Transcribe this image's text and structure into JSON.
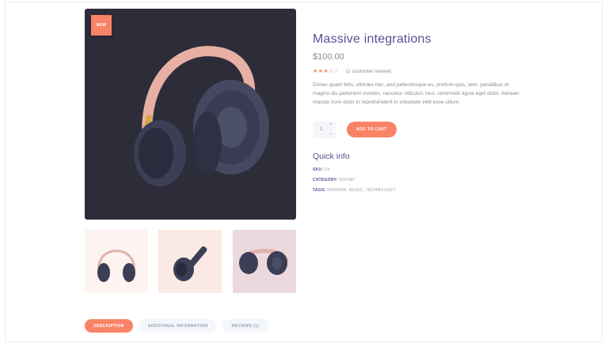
{
  "product": {
    "badge": "NEW",
    "title": "Massive integrations",
    "price": "$100.00",
    "rating": 3,
    "rating_stars": "★★★☆☆",
    "reviews_text": "(1 customer review)",
    "description": "Donec quam felis, ultricies nec, and pellentesque eu, pretium quis, sem. penatibus et magnis dis parturient montes, nascetur ridiculus mus. commodo ligula eget dolor. Aenean masste irure dolor in reprehenderit in voluptate velit esse cillum.",
    "quantity": "1",
    "add_to_cart": "ADD TO CART"
  },
  "quick_info": {
    "title": "Quick info",
    "sku_label": "SKU:",
    "sku_value": "04",
    "category_label": "CATEGORY:",
    "category_value": "SOUND",
    "tags_label": "TAGS:",
    "tags_value": "FASHION, MUSIC, TECHNOLOGY"
  },
  "tabs": [
    {
      "label": "DESCRIPTION"
    },
    {
      "label": "ADDITIONAL INFORMATION"
    },
    {
      "label": "REVIEWS (1)"
    }
  ],
  "colors": {
    "accent": "#f98367",
    "heading": "#5a4d94",
    "image_bg": "#2d2d3a"
  },
  "icons": {
    "headphones": "headphones-icon",
    "qty_up": "chevron-up-icon",
    "qty_down": "chevron-down-icon"
  }
}
